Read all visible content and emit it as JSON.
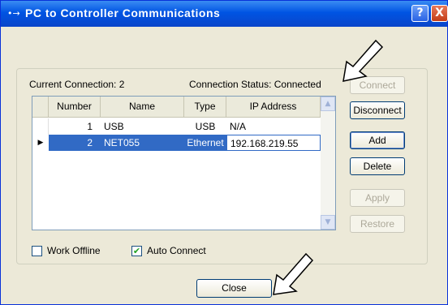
{
  "window": {
    "title": "PC to Controller Communications",
    "title_icon": "•→",
    "help": "?",
    "close": "X"
  },
  "status": {
    "current": "Current Connection: 2",
    "connection": "Connection Status: Connected"
  },
  "table": {
    "columns": [
      "Number",
      "Name",
      "Type",
      "IP Address"
    ],
    "rows": [
      {
        "number": "1",
        "name": "USB",
        "type": "USB",
        "ip": "N/A",
        "selected": false
      },
      {
        "number": "2",
        "name": "NET055",
        "type": "Ethernet",
        "ip": "192.168.219.55",
        "selected": true
      }
    ],
    "selected_marker": "▶"
  },
  "buttons": {
    "connect": "Connect",
    "disconnect": "Disconnect",
    "add": "Add",
    "delete": "Delete",
    "apply": "Apply",
    "restore": "Restore",
    "close": "Close"
  },
  "checkboxes": {
    "work_offline": {
      "label": "Work Offline",
      "checked": false
    },
    "auto_connect": {
      "label": "Auto Connect",
      "checked": true
    }
  },
  "icons": {
    "check": "✔",
    "scroll_up": "▲",
    "scroll_down": "▼"
  }
}
